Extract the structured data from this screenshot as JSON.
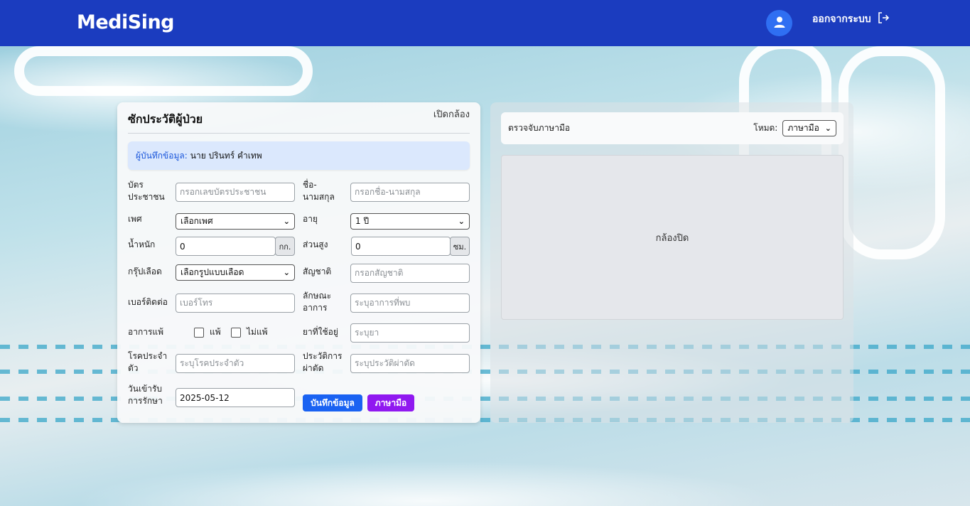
{
  "header": {
    "brand": "MediSing",
    "logout_label": "ออกจากระบบ",
    "color": "#1b3cbf"
  },
  "patient_form": {
    "title": "ซักประวัติผู้ป่วย",
    "open_camera": "เปิดกล้อง",
    "recorder_label": "ผู้บันทึกข้อมูล:",
    "recorder_name": "นาย ปรินทร์ คำเทพ",
    "id_card": {
      "label_1": "บัตร",
      "label_2": "ประชาชน",
      "placeholder": "กรอกเลขบัตรประชาชน"
    },
    "full_name": {
      "label_1": "ชื่อ-",
      "label_2": "นามสกุล",
      "placeholder": "กรอกชื่อ-นามสกุล"
    },
    "gender": {
      "label": "เพศ",
      "selected": "เลือกเพศ"
    },
    "age": {
      "label": "อายุ",
      "selected": "1 ปี"
    },
    "weight": {
      "label": "น้ำหนัก",
      "value": "0",
      "unit": "กก."
    },
    "height": {
      "label": "ส่วนสูง",
      "value": "0",
      "unit": "ซม."
    },
    "blood_type": {
      "label": "กรุ๊ปเลือด",
      "selected": "เลือกรูปแบบเลือด"
    },
    "nationality": {
      "label": "สัญชาติ",
      "placeholder": "กรอกสัญชาติ"
    },
    "phone": {
      "label": "เบอร์ติดต่อ",
      "placeholder": "เบอร์โทร"
    },
    "symptoms": {
      "label_1": "ลักษณะ",
      "label_2": "อาการ",
      "placeholder": "ระบุอาการที่พบ"
    },
    "allergy": {
      "label": "อาการแพ้",
      "option_yes": "แพ้",
      "option_no": "ไม่แพ้"
    },
    "medication": {
      "label": "ยาที่ใช้อยู่",
      "placeholder": "ระบุยา"
    },
    "chronic": {
      "label_1": "โรคประจำ",
      "label_2": "ตัว",
      "placeholder": "ระบุโรคประจำตัว"
    },
    "surgery": {
      "label_1": "ประวัติการ",
      "label_2": "ผ่าตัด",
      "placeholder": "ระบุประวัติผ่าตัด"
    },
    "admit_date": {
      "label_1": "วันเข้ารับ",
      "label_2": "การรักษา",
      "value": "2025-05-12"
    },
    "save_button": "บันทึกข้อมูล",
    "sign_button": "ภาษามือ"
  },
  "detector": {
    "title": "ตรวจจับภาษามือ",
    "mode_label": "โหมด:",
    "mode_selected": "ภาษามือ",
    "camera_status": "กล้องปิด"
  },
  "icons": {
    "avatar": "user-icon",
    "logout": "logout-icon"
  }
}
